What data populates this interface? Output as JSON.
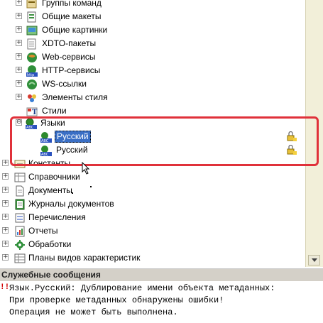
{
  "tree": {
    "sub_items": [
      {
        "label": "Группы команд",
        "icon": "command-groups-icon"
      },
      {
        "label": "Общие макеты",
        "icon": "common-templates-icon"
      },
      {
        "label": "Общие картинки",
        "icon": "common-pictures-icon"
      },
      {
        "label": "XDTO-пакеты",
        "icon": "xdto-packages-icon"
      },
      {
        "label": "Web-сервисы",
        "icon": "web-services-icon"
      },
      {
        "label": "HTTP-сервисы",
        "icon": "http-services-icon"
      },
      {
        "label": "WS-ссылки",
        "icon": "ws-references-icon"
      },
      {
        "label": "Элементы стиля",
        "icon": "style-items-icon"
      },
      {
        "label": "Стили",
        "icon": "styles-icon"
      }
    ],
    "languages": {
      "label": "Языки",
      "expander": "⊖",
      "children": [
        {
          "label": "Русский",
          "selected": true
        },
        {
          "label": "Русский",
          "selected": false
        }
      ]
    },
    "top_items": [
      {
        "label": "Константы",
        "icon": "constants-icon"
      },
      {
        "label": "Справочники",
        "icon": "catalogs-icon"
      },
      {
        "label": "Документы",
        "icon": "documents-icon"
      },
      {
        "label": "Журналы документов",
        "icon": "document-journals-icon"
      },
      {
        "label": "Перечисления",
        "icon": "enums-icon"
      },
      {
        "label": "Отчеты",
        "icon": "reports-icon"
      },
      {
        "label": "Обработки",
        "icon": "data-processors-icon"
      },
      {
        "label": "Планы видов характеристик",
        "icon": "chart-of-characteristic-types-icon"
      }
    ],
    "expander": "+"
  },
  "messages": {
    "title": "Служебные сообщения",
    "error_marker": "!!",
    "lines": [
      "Язык.Русский: Дублирование имени объекта метаданных:",
      "При проверке метаданных обнаружены ошибки!",
      "Операция не может быть выполнена."
    ]
  },
  "colors": {
    "highlight": "#e0313a",
    "selection": "#3a6fc5",
    "panel_header": "#d4d0c8"
  }
}
